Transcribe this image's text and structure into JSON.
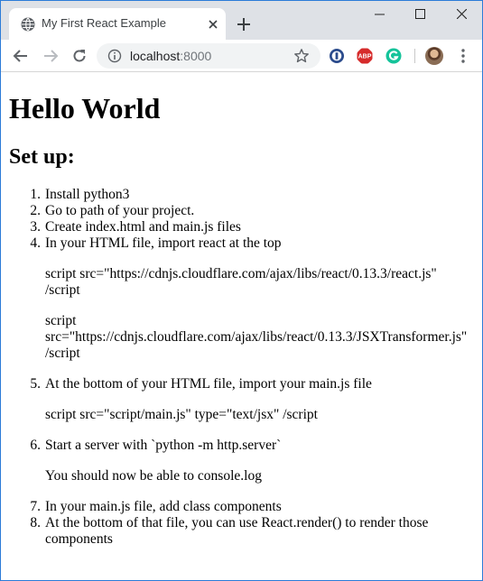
{
  "browser": {
    "tab_title": "My First React Example",
    "url_host": "localhost",
    "url_port": ":8000"
  },
  "page": {
    "heading": "Hello World",
    "subheading": "Set up:",
    "steps": [
      {
        "number": "1.",
        "text": "Install python3"
      },
      {
        "number": "2.",
        "text": "Go to path of your project."
      },
      {
        "number": "3.",
        "text": "Create index.html and main.js files"
      },
      {
        "number": "4.",
        "text": "In your HTML file, import react at the top",
        "code_1a": "script src=\"https://cdnjs.cloudflare.com/ajax/libs/react/0.13.3/react.js\"",
        "code_1b": "/script",
        "code_2a": "script",
        "code_2b": "src=\"https://cdnjs.cloudflare.com/ajax/libs/react/0.13.3/JSXTransformer.js\"",
        "code_2c": "/script"
      },
      {
        "number": "5.",
        "text": "At the bottom of your HTML file, import your main.js file",
        "code_1": "script src=\"script/main.js\" type=\"text/jsx\" /script"
      },
      {
        "number": "6.",
        "text": "Start a server with `python -m http.server`",
        "note": "You should now be able to console.log"
      },
      {
        "number": "7.",
        "text": "In your main.js file, add class components"
      },
      {
        "number": "8.",
        "text": "At the bottom of that file, you can use React.render() to render those components"
      }
    ]
  },
  "icons": {
    "favicon": "globe-icon",
    "extensions": [
      "password-manager-icon",
      "adblock-plus-icon",
      "grammarly-icon"
    ]
  },
  "colors": {
    "tabstrip": "#dee1e6",
    "window_border": "#2b7bd8",
    "abp_red": "#d62b2b",
    "grammarly_green": "#15c39a"
  }
}
